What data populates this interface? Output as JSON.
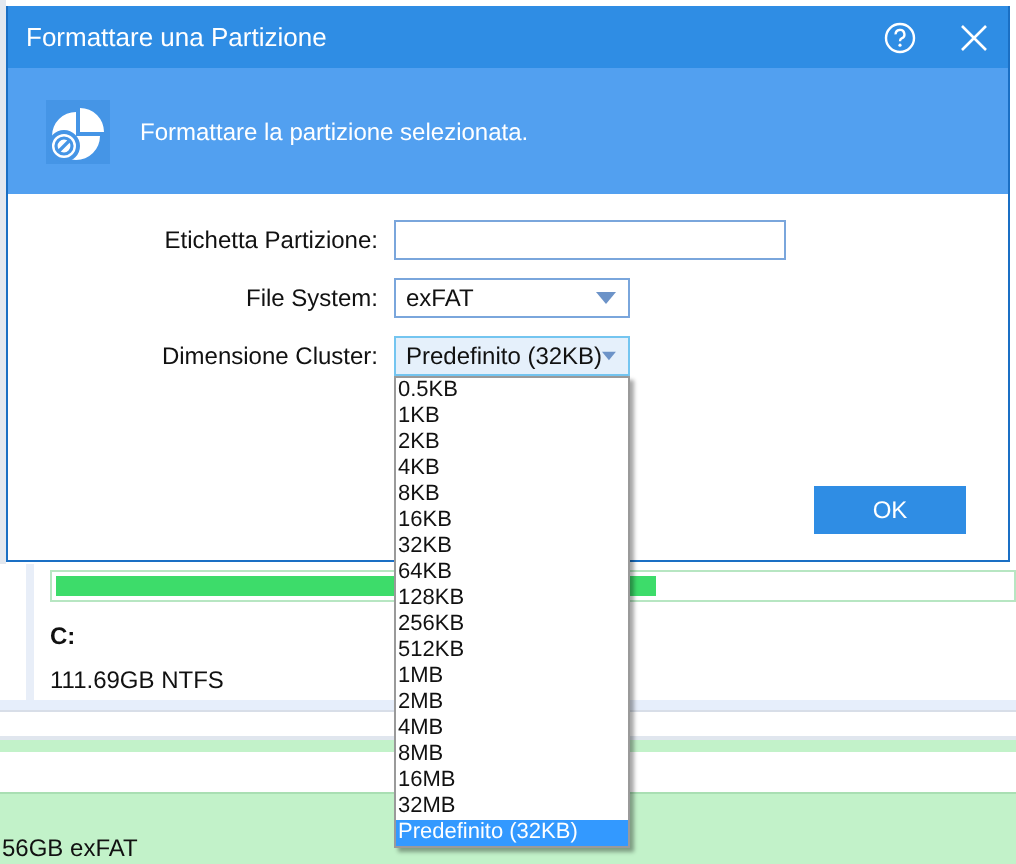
{
  "background": {
    "partition": {
      "name": "C:",
      "info": "111.69GB NTFS"
    },
    "bottom_row": "56GB exFAT"
  },
  "dialog": {
    "title": "Formattare una Partizione",
    "banner": "Formattare la partizione selezionata.",
    "fields": [
      {
        "kind": "text",
        "label": "Etichetta Partizione:"
      },
      {
        "kind": "select",
        "label": "File System:",
        "value": "exFAT",
        "open": false
      },
      {
        "kind": "select",
        "label": "Dimensione Cluster:",
        "value": "Predefinito (32KB)",
        "open": true,
        "options": [
          {
            "label": "0.5KB",
            "selected": false
          },
          {
            "label": "1KB",
            "selected": false
          },
          {
            "label": "2KB",
            "selected": false
          },
          {
            "label": "4KB",
            "selected": false
          },
          {
            "label": "8KB",
            "selected": false
          },
          {
            "label": "16KB",
            "selected": false
          },
          {
            "label": "32KB",
            "selected": false
          },
          {
            "label": "64KB",
            "selected": false
          },
          {
            "label": "128KB",
            "selected": false
          },
          {
            "label": "256KB",
            "selected": false
          },
          {
            "label": "512KB",
            "selected": false
          },
          {
            "label": "1MB",
            "selected": false
          },
          {
            "label": "2MB",
            "selected": false
          },
          {
            "label": "4MB",
            "selected": false
          },
          {
            "label": "8MB",
            "selected": false
          },
          {
            "label": "16MB",
            "selected": false
          },
          {
            "label": "32MB",
            "selected": false
          },
          {
            "label": "Predefinito (32KB)",
            "selected": true
          }
        ]
      }
    ],
    "buttons": [
      "OK"
    ]
  }
}
